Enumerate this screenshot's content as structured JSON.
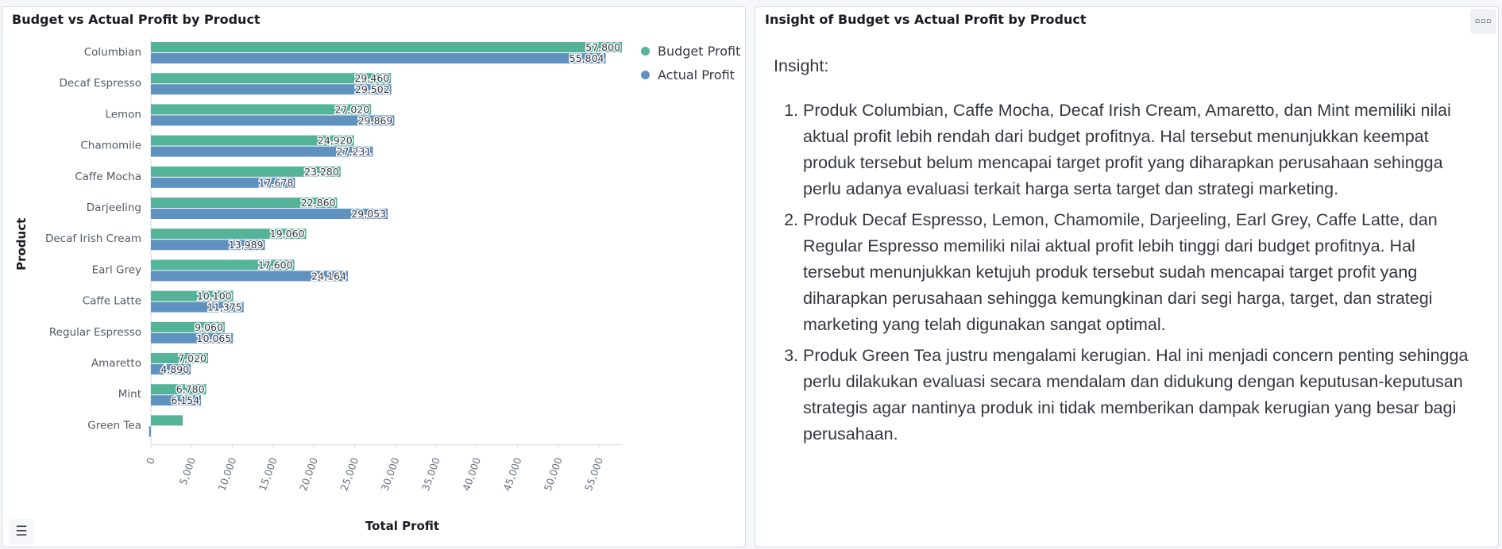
{
  "chart_panel": {
    "title": "Budget vs Actual Profit by Product"
  },
  "insight_panel": {
    "title": "Insight of Budget vs Actual Profit by Product",
    "heading": "Insight:",
    "items": [
      "Produk Columbian, Caffe Mocha, Decaf Irish Cream, Amaretto, dan Mint memiliki nilai aktual profit lebih rendah dari budget profitnya. Hal tersebut menunjukkan keempat produk tersebut belum mencapai target profit yang diharapkan perusahaan sehingga perlu adanya evaluasi terkait harga serta target dan strategi marketing.",
      "Produk Decaf Espresso, Lemon, Chamomile, Darjeeling, Earl Grey, Caffe Latte, dan Regular Espresso memiliki nilai aktual profit lebih tinggi dari budget profitnya. Hal tersebut menunjukkan ketujuh produk tersebut sudah mencapai target profit yang diharapkan perusahaan sehingga kemungkinan dari segi harga, target, dan strategi marketing yang telah digunakan sangat optimal.",
      "Produk Green Tea justru mengalami kerugian. Hal ini menjadi concern penting sehingga perlu dilakukan evaluasi secara mendalam dan didukung dengan keputusan-keputusan strategis agar nantinya produk ini tidak memberikan dampak kerugian yang besar bagi perusahaan."
    ]
  },
  "icons": {
    "toc": "list-icon",
    "panel_menu": "ellipsis-icon"
  },
  "chart_data": {
    "type": "bar",
    "orientation": "horizontal",
    "title": "Budget vs Actual Profit by Product",
    "xlabel": "Total Profit",
    "ylabel": "Product",
    "xlim": [
      0,
      57800
    ],
    "x_ticks": [
      0,
      5000,
      10000,
      15000,
      20000,
      25000,
      30000,
      35000,
      40000,
      45000,
      50000,
      55000
    ],
    "x_tick_labels": [
      "0",
      "5,000",
      "10,000",
      "15,000",
      "20,000",
      "25,000",
      "30,000",
      "35,000",
      "40,000",
      "45,000",
      "50,000",
      "55,000"
    ],
    "legend_position": "top-right",
    "grid": false,
    "categories": [
      "Columbian",
      "Decaf Espresso",
      "Lemon",
      "Chamomile",
      "Caffe Mocha",
      "Darjeeling",
      "Decaf Irish Cream",
      "Earl Grey",
      "Caffe Latte",
      "Regular Espresso",
      "Amaretto",
      "Mint",
      "Green Tea"
    ],
    "series": [
      {
        "name": "Budget Profit",
        "color": "#54b399",
        "values": [
          57800,
          29460,
          27020,
          24920,
          23280,
          22860,
          19060,
          17600,
          10100,
          9060,
          7020,
          6780,
          3900
        ],
        "labels": [
          "57,800",
          "29,460",
          "27,020",
          "24,920",
          "23,280",
          "22,860",
          "19,060",
          "17,600",
          "10,100",
          "9,060",
          "7,020",
          "6,780",
          ""
        ]
      },
      {
        "name": "Actual Profit",
        "color": "#6092c0",
        "values": [
          55804,
          29502,
          29869,
          27231,
          17678,
          29053,
          13989,
          24164,
          11375,
          10065,
          4890,
          6154,
          -231
        ],
        "labels": [
          "55,804",
          "29,502",
          "29,869",
          "27,231",
          "17,678",
          "29,053",
          "13,989",
          "24,164",
          "11,375",
          "10,065",
          "4,890",
          "6,154",
          ""
        ]
      }
    ]
  }
}
